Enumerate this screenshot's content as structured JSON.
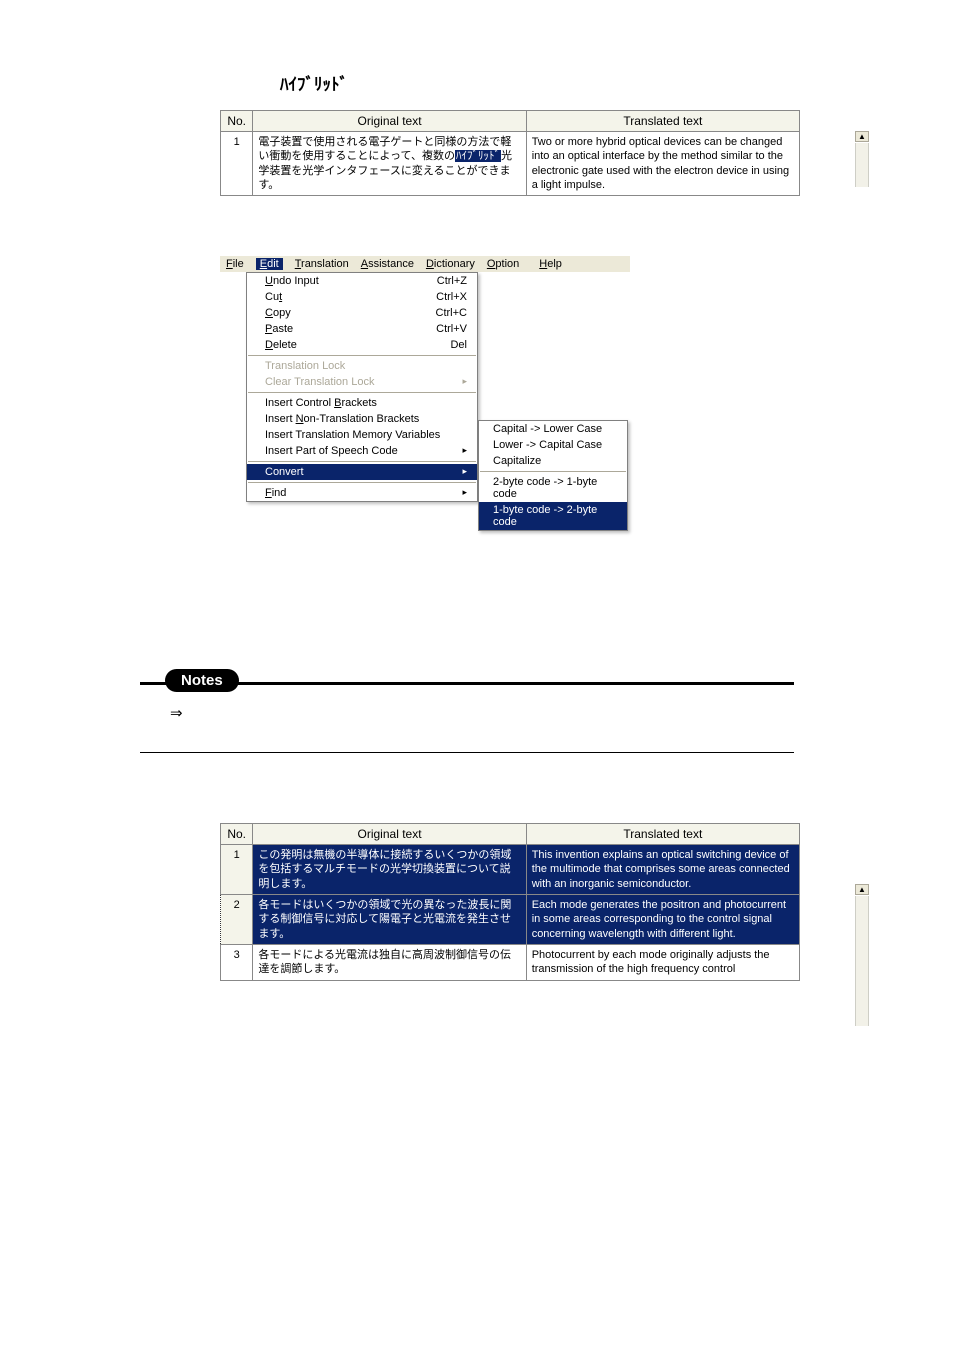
{
  "search_term": "ﾊｲﾌﾞﾘｯﾄﾞ",
  "table1": {
    "headers": {
      "no": "No.",
      "original": "Original text",
      "translated": "Translated text"
    },
    "rows": [
      {
        "no": "1",
        "orig_pre": "電子装置で使用される電子ゲートと同様の方法で軽い衝動を使用することによって、複数の",
        "orig_hl": "ﾊｲﾌﾞﾘｯﾄﾞ",
        "orig_post": "光学装置を光学インタフェースに変えることができます。",
        "translated": "Two or more hybrid optical devices can be changed into an optical interface by the method similar to the electronic gate used with the electron device in using a light impulse."
      }
    ]
  },
  "menubar": [
    "File",
    "Edit",
    "Translation",
    "Assistance",
    "Dictionary",
    "Option",
    "Help"
  ],
  "edit_menu": {
    "items": [
      {
        "label": "Undo Input",
        "shortcut": "Ctrl+Z"
      },
      {
        "label": "Cut",
        "shortcut": "Ctrl+X"
      },
      {
        "label": "Copy",
        "shortcut": "Ctrl+C"
      },
      {
        "label": "Paste",
        "shortcut": "Ctrl+V"
      },
      {
        "label": "Delete",
        "shortcut": "Del"
      }
    ],
    "disabled": [
      {
        "label": "Translation Lock"
      },
      {
        "label": "Clear Translation Lock",
        "arrow": true
      }
    ],
    "insert": [
      {
        "label": "Insert Control Brackets"
      },
      {
        "label": "Insert Non-Translation Brackets"
      },
      {
        "label": "Insert Translation Memory Variables"
      },
      {
        "label": "Insert Part of Speech Code",
        "arrow": true
      }
    ],
    "convert": {
      "label": "Convert",
      "arrow": true
    },
    "find": {
      "label": "Find",
      "arrow": true
    }
  },
  "convert_submenu": [
    "Capital -> Lower Case",
    "Lower -> Capital Case",
    "Capitalize",
    "2-byte code -> 1-byte code",
    "1-byte code -> 2-byte code"
  ],
  "notes_label": "Notes",
  "notes_arrow": "⇒",
  "table2": {
    "headers": {
      "no": "No.",
      "original": "Original text",
      "translated": "Translated text"
    },
    "rows": [
      {
        "no": "1",
        "original": "この発明は無機の半導体に接続するいくつかの領域を包括するマルチモードの光学切換装置について説明します。",
        "translated": "This invention explains an optical switching device of the multimode that comprises some areas connected with an inorganic semiconductor."
      },
      {
        "no": "2",
        "original": "各モードはいくつかの領域で光の異なった波長に関する制御信号に対応して陽電子と光電流を発生させます。",
        "translated": "Each mode generates the positron and photocurrent in some areas corresponding to the control signal concerning wavelength with different light."
      },
      {
        "no": "3",
        "original": "各モードによる光電流は独自に高周波制御信号の伝達を調節します。",
        "translated": "Photocurrent by each mode originally adjusts the transmission of the high frequency control"
      }
    ]
  }
}
